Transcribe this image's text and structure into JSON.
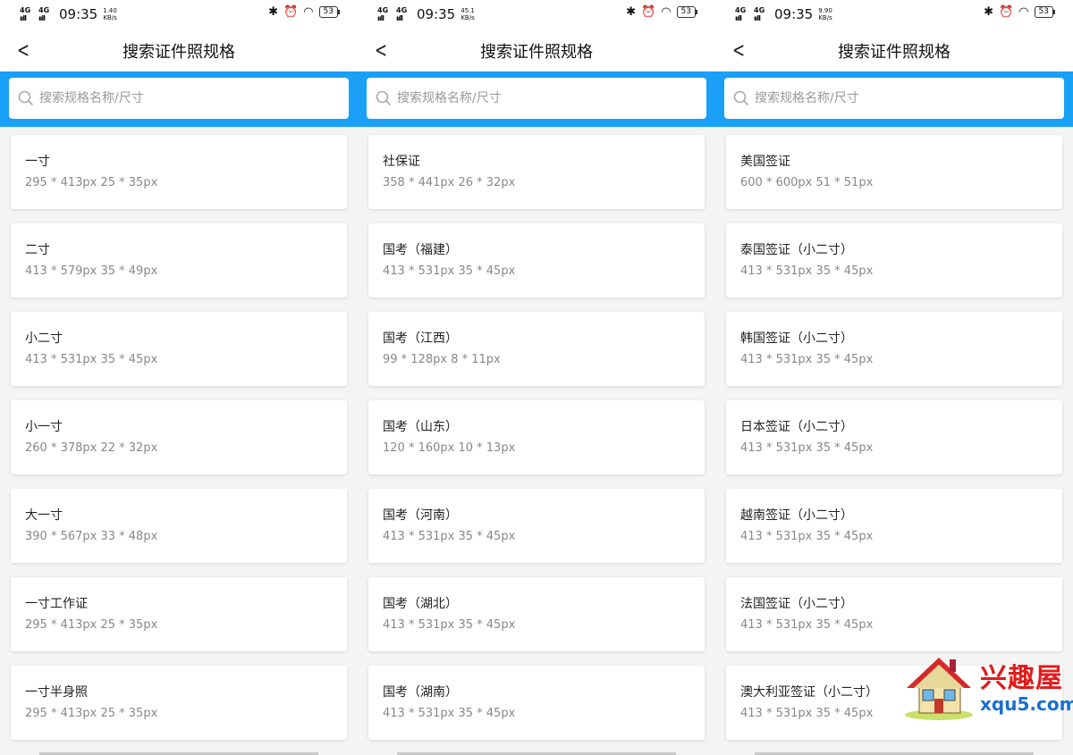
{
  "panels": [
    {
      "status": {
        "net1": "4G",
        "net2": "4G",
        "time": "09:35",
        "speed_top": "1.40",
        "speed_unit": "KB/s",
        "battery": "53"
      },
      "title": "搜索证件照规格",
      "search_placeholder": "搜索规格名称/尺寸",
      "items": [
        {
          "name": "一寸",
          "size": "295 * 413px   25 * 35px"
        },
        {
          "name": "二寸",
          "size": "413 * 579px   35 * 49px"
        },
        {
          "name": "小二寸",
          "size": "413 * 531px   35 * 45px"
        },
        {
          "name": "小一寸",
          "size": "260 * 378px   22 * 32px"
        },
        {
          "name": "大一寸",
          "size": "390 * 567px   33 * 48px"
        },
        {
          "name": "一寸工作证",
          "size": "295 * 413px   25 * 35px"
        },
        {
          "name": "一寸半身照",
          "size": "295 * 413px   25 * 35px"
        }
      ]
    },
    {
      "status": {
        "net1": "4G",
        "net2": "4G",
        "time": "09:35",
        "speed_top": "45.1",
        "speed_unit": "KB/s",
        "battery": "53"
      },
      "title": "搜索证件照规格",
      "search_placeholder": "搜索规格名称/尺寸",
      "items": [
        {
          "name": "社保证",
          "size": "358 * 441px   26 * 32px"
        },
        {
          "name": "国考（福建）",
          "size": "413 * 531px   35 * 45px"
        },
        {
          "name": "国考（江西）",
          "size": "99 * 128px   8 * 11px"
        },
        {
          "name": "国考（山东）",
          "size": "120 * 160px   10 * 13px"
        },
        {
          "name": "国考（河南）",
          "size": "413 * 531px   35 * 45px"
        },
        {
          "name": "国考（湖北）",
          "size": "413 * 531px   35 * 45px"
        },
        {
          "name": "国考（湖南）",
          "size": "413 * 531px   35 * 45px"
        }
      ]
    },
    {
      "status": {
        "net1": "4G",
        "net2": "4G",
        "time": "09:35",
        "speed_top": "9.90",
        "speed_unit": "KB/s",
        "battery": "53"
      },
      "title": "搜索证件照规格",
      "search_placeholder": "搜索规格名称/尺寸",
      "items": [
        {
          "name": "美国签证",
          "size": "600 * 600px   51 * 51px"
        },
        {
          "name": "泰国签证（小二寸）",
          "size": "413 * 531px   35 * 45px"
        },
        {
          "name": "韩国签证（小二寸）",
          "size": "413 * 531px   35 * 45px"
        },
        {
          "name": "日本签证（小二寸）",
          "size": "413 * 531px   35 * 45px"
        },
        {
          "name": "越南签证（小二寸）",
          "size": "413 * 531px   35 * 45px"
        },
        {
          "name": "法国签证（小二寸）",
          "size": "413 * 531px   35 * 45px"
        },
        {
          "name": "澳大利亚签证（小二寸）",
          "size": "413 * 531px   35 * 45px"
        }
      ]
    }
  ],
  "watermark": {
    "name": "兴趣屋",
    "url": "xqu5.com"
  },
  "colors": {
    "accent": "#1aa0f7",
    "card": "#ffffff",
    "background": "#f4f4f4",
    "secondary_text": "#888888"
  }
}
